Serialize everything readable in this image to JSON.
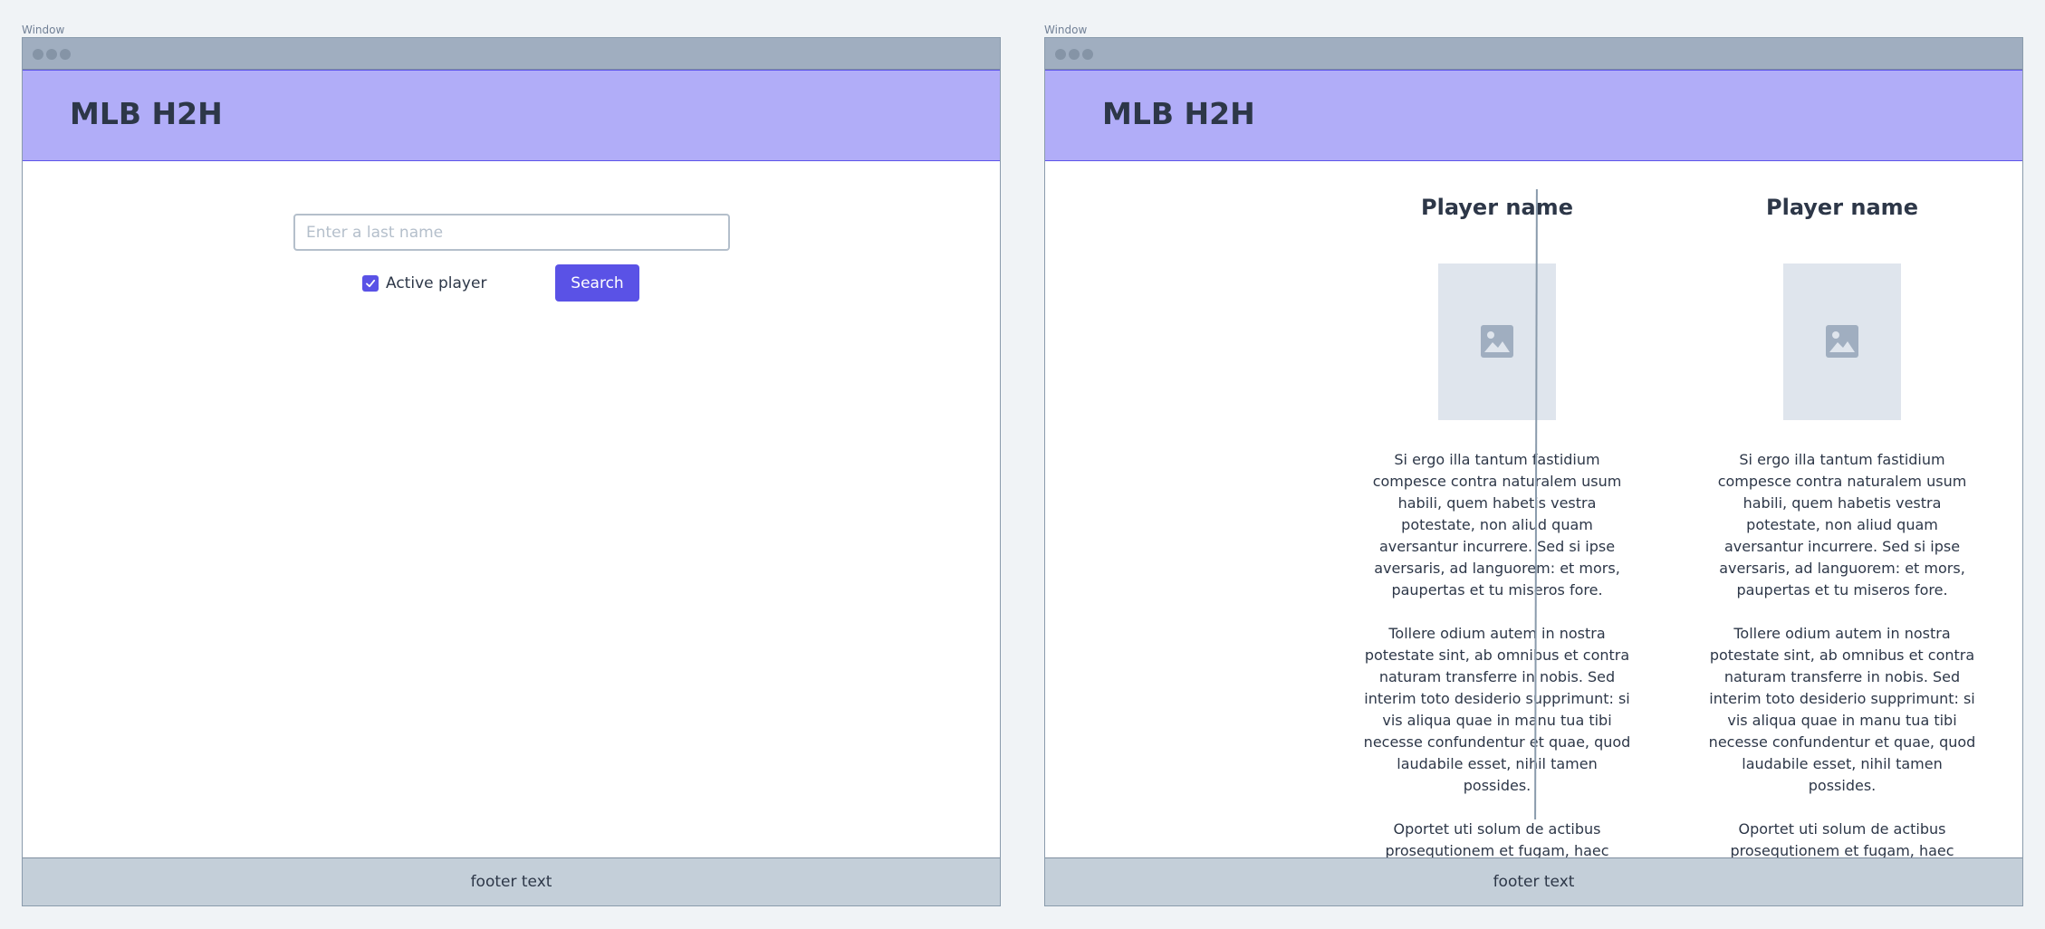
{
  "windows": [
    {
      "caption": "Window",
      "app_title": "MLB H2H",
      "search": {
        "placeholder": "Enter a last name",
        "value": ""
      },
      "active_player": {
        "label": "Active player",
        "checked": true
      },
      "search_button": "Search",
      "footer": "footer text"
    },
    {
      "caption": "Window",
      "app_title": "MLB H2H",
      "players": [
        {
          "name": "Player name",
          "bio": [
            "Si ergo illa tantum fastidium compesce contra naturalem usum habili, quem habetis vestra potestate, non aliud quam aversantur incurrere. Sed si ipse aversaris, ad languorem: et mors, paupertas et tu miseros fore.",
            "Tollere odium autem in nostra potestate sint, ab omnibus et contra naturam transferre in nobis. Sed interim toto desiderio supprimunt: si vis aliqua quae in manu tua tibi necesse confundentur et quae, quod laudabile esset, nihil tamen possides.",
            "Oportet uti solum de actibus prosequtionem et fugam, haec leniter"
          ]
        },
        {
          "name": "Player name",
          "bio": [
            "Si ergo illa tantum fastidium compesce contra naturalem usum habili, quem habetis vestra potestate, non aliud quam aversantur incurrere. Sed si ipse aversaris, ad languorem: et mors, paupertas et tu miseros fore.",
            "Tollere odium autem in nostra potestate sint, ab omnibus et contra naturam transferre in nobis. Sed interim toto desiderio supprimunt: si vis aliqua quae in manu tua tibi necesse confundentur et quae, quod laudabile esset, nihil tamen possides.",
            "Oportet uti solum de actibus prosequtionem et fugam, haec leniter"
          ]
        }
      ],
      "footer": "footer text"
    }
  ],
  "colors": {
    "accent": "#5a52e6",
    "header_bg": "#b1adf8",
    "footer_bg": "#c4cfd9",
    "placeholder_bg": "#dfe5ed"
  },
  "icons": {
    "photo_placeholder": "image-icon",
    "checkbox": "checkmark-icon"
  }
}
